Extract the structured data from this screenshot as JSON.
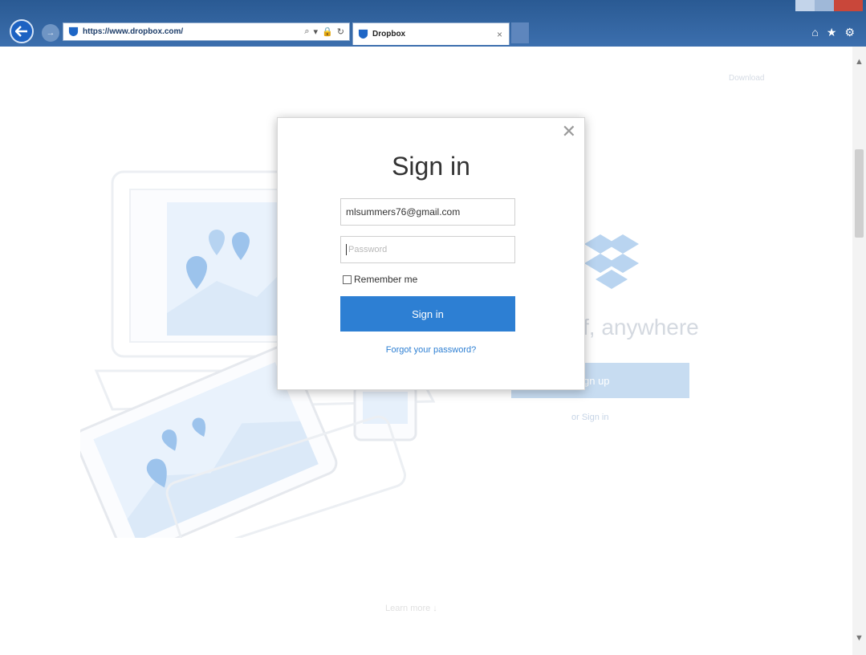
{
  "browser": {
    "address": "https://www.dropbox.com/",
    "tab_title": "Dropbox",
    "tab_close": "×",
    "back_label": "←",
    "address_tools": [
      "⌕",
      "▾",
      "🔒",
      "↻"
    ]
  },
  "background": {
    "download_label": "Download",
    "hero_text": "f, anywhere",
    "signup_label": "gn up",
    "signin_label": "or Sign in",
    "learn_more": "Learn more ↓"
  },
  "modal": {
    "close_label": "✕",
    "title": "Sign in",
    "email_value": "mlsummers76@gmail.com",
    "password_placeholder": "Password",
    "remember_label": "Remember me",
    "signin_button": "Sign in",
    "forgot_link": "Forgot your password?"
  },
  "colors": {
    "accent": "#2d7fd3",
    "chrome": "#2a5a93",
    "illustration_tint": "#dbe9f8"
  }
}
